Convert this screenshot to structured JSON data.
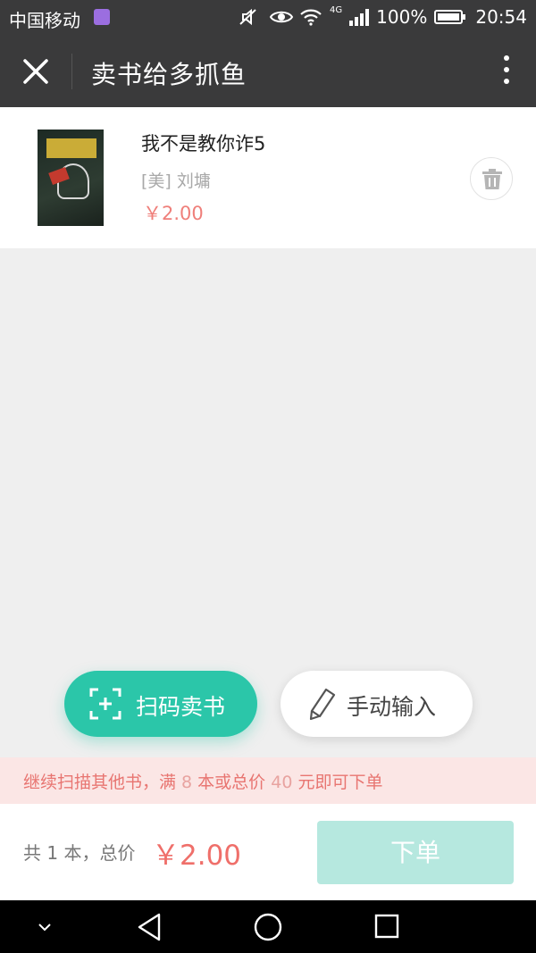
{
  "status_bar": {
    "carrier": "中国移动",
    "network": "4G",
    "battery": "100%",
    "time": "20:54"
  },
  "nav": {
    "title": "卖书给多抓鱼"
  },
  "book": {
    "title": "我不是教你诈5",
    "author": "[美] 刘墉",
    "price": "￥2.00"
  },
  "actions": {
    "scan_label": "扫码卖书",
    "manual_label": "手动输入"
  },
  "notice": {
    "part1": "继续扫描其他书，满 ",
    "count": "8",
    "part2": " 本或总价 ",
    "amount": "40",
    "part3": " 元即可下单"
  },
  "order": {
    "summary": "共 1 本，总价",
    "total": "￥2.00",
    "submit_label": "下单"
  },
  "colors": {
    "accent": "#2bc6a9",
    "price": "#ef6f6a",
    "order_disabled": "#b6e8df",
    "header": "#3a3a3b"
  }
}
